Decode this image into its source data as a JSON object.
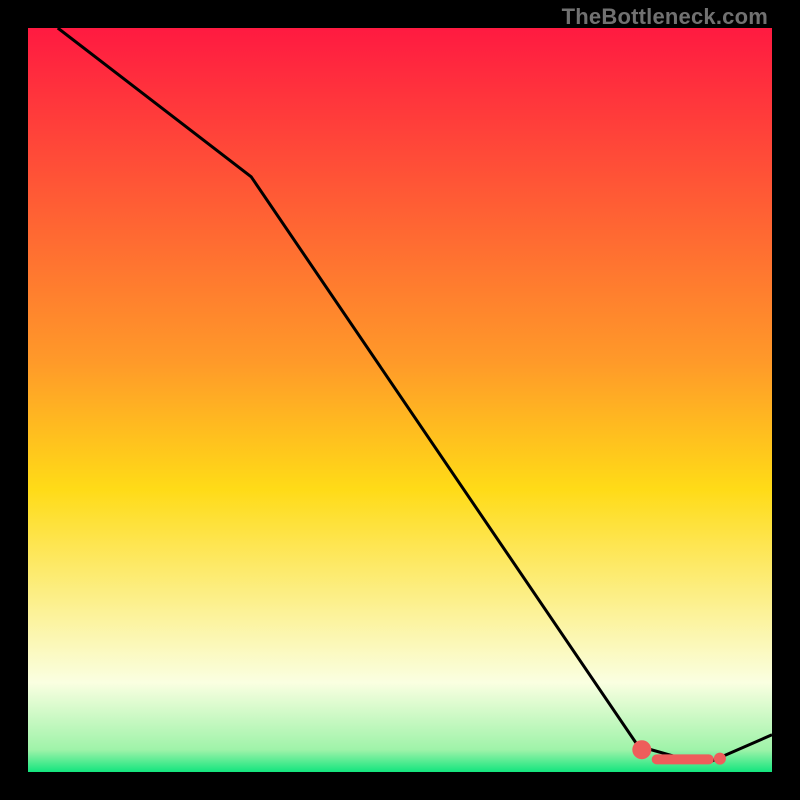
{
  "watermark": "TheBottleneck.com",
  "colors": {
    "frame": "#000000",
    "grad_top": "#ff1a41",
    "grad_mid": "#ffdb17",
    "grad_low": "#faffe1",
    "grad_bottom": "#13e57e",
    "curve": "#000000",
    "marker": "#ee5d5b"
  },
  "chart_data": {
    "type": "line",
    "title": "",
    "xlabel": "",
    "ylabel": "",
    "xlim": [
      0,
      100
    ],
    "ylim": [
      0,
      100
    ],
    "series": [
      {
        "name": "curve",
        "x": [
          4,
          30,
          82,
          89,
          92,
          100
        ],
        "values": [
          100,
          80,
          3.5,
          1.5,
          1.5,
          5
        ]
      }
    ],
    "markers": [
      {
        "name": "trough-left-cap",
        "shape": "round",
        "x": 82.5,
        "y": 3.0,
        "r": 9.5
      },
      {
        "name": "trough-capsule",
        "shape": "capsule",
        "x0": 84.5,
        "y0": 1.7,
        "x1": 91.5,
        "y1": 1.7,
        "r": 5
      },
      {
        "name": "trough-right-dot",
        "shape": "round",
        "x": 93.0,
        "y": 1.8,
        "r": 6
      }
    ]
  }
}
